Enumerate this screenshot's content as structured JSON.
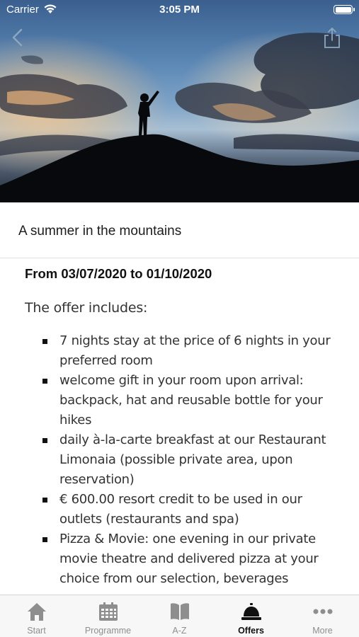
{
  "status_bar": {
    "carrier": "Carrier",
    "time": "3:05 PM",
    "wifi_icon": "wifi-icon",
    "battery_icon": "battery-icon"
  },
  "header": {
    "back_icon": "chevron-left-icon",
    "share_icon": "share-icon"
  },
  "offer": {
    "title": "A summer in the mountains",
    "dates": "From 03/07/2020 to 01/10/2020",
    "intro": "The offer includes:",
    "items": [
      "7 nights stay at the price of 6 nights in your preferred room",
      "welcome gift in your room upon arrival: backpack, hat and reusable bottle for your hikes",
      "daily à-la-carte breakfast at our Restaurant Limonaia (possible private area, upon reservation)",
      "€ 600.00 resort credit to be used in our outlets (restaurants and spa)",
      "Pizza & Movie: one evening in our private movie theatre and delivered pizza at your choice from our selection, beverages"
    ]
  },
  "tabbar": {
    "tabs": [
      {
        "label": "Start",
        "icon": "house-icon",
        "active": false
      },
      {
        "label": "Programme",
        "icon": "calendar-icon",
        "active": false
      },
      {
        "label": "A-Z",
        "icon": "book-icon",
        "active": false
      },
      {
        "label": "Offers",
        "icon": "reception-bell-icon",
        "active": true
      },
      {
        "label": "More",
        "icon": "more-dots-icon",
        "active": false
      }
    ]
  },
  "colors": {
    "accent_active": "#111111",
    "inactive": "#8e8e8e",
    "tabbar_bg": "#f7f7f7"
  }
}
